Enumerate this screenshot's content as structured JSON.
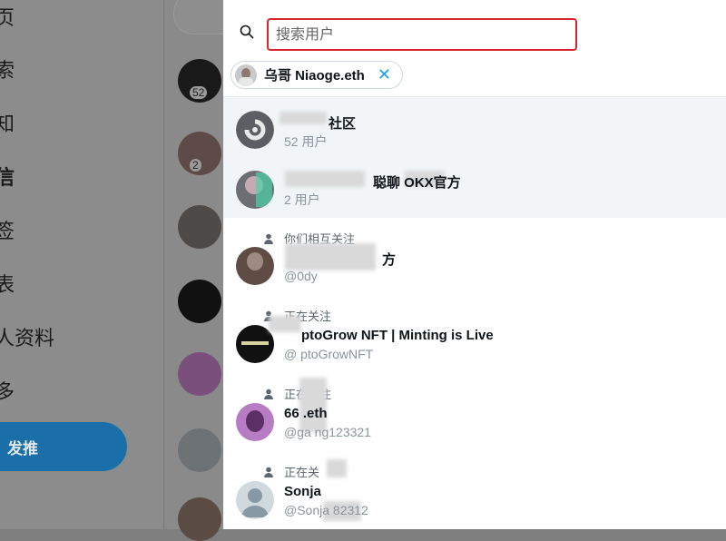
{
  "background": {
    "nav_items": [
      "页",
      "索",
      "知",
      "信",
      "签",
      "表",
      "人资料",
      "多"
    ],
    "post_button": "发推",
    "badges": [
      "52",
      "2"
    ]
  },
  "search": {
    "placeholder": "搜索用户",
    "value": ""
  },
  "selected_chip": {
    "label": "乌哥 Niaoge.eth",
    "close_icon": "close-icon"
  },
  "results": [
    {
      "name": "社区",
      "sub": "52 用户",
      "selected": true
    },
    {
      "name": "聪聊          OKX官方",
      "sub": "2 用户",
      "selected": true
    },
    {
      "relation": "你们相互关注",
      "name": "方",
      "handle": "@0dy"
    },
    {
      "relation": "正在关注",
      "name": "ptoGrow NFT | Minting is Live",
      "handle": "@ ptoGrowNFT"
    },
    {
      "relation": "正在关注",
      "name": "66     .eth",
      "handle": "@ga       ng123321"
    },
    {
      "relation": "正在关",
      "name": "Sonja",
      "handle": "@Sonja       82312"
    }
  ],
  "colors": {
    "accent": "#1d9bf0",
    "highlight_border": "#d8262b",
    "overlay": "#7f7f7f"
  }
}
